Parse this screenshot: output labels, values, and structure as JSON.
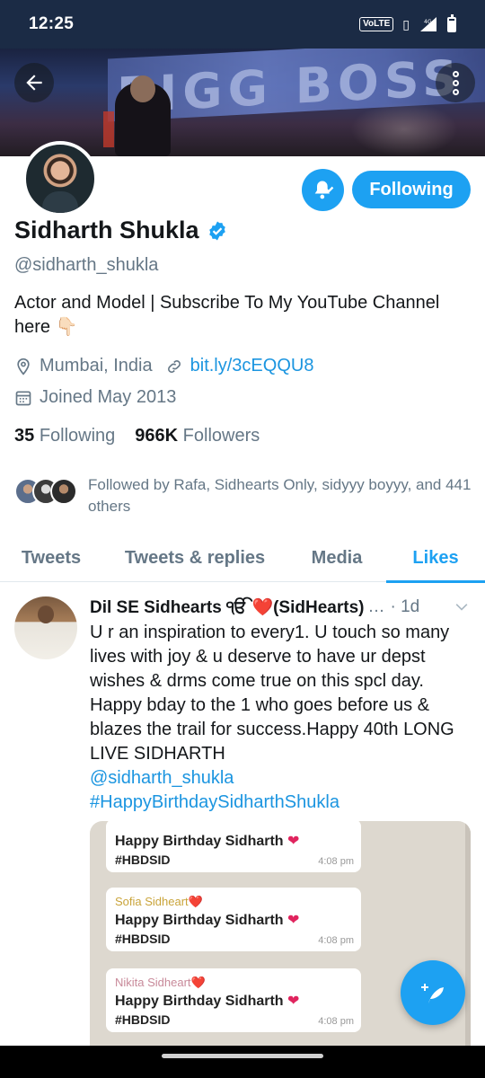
{
  "status_bar": {
    "time": "12:25",
    "volte": "VoLTE",
    "network": "4G"
  },
  "profile": {
    "name": "Sidharth Shukla",
    "handle": "@sidharth_shukla",
    "bio": "Actor and Model | Subscribe To My YouTube Channel here 👇🏻",
    "location": "Mumbai, India",
    "link": "bit.ly/3cEQQU8",
    "joined": "Joined May 2013",
    "following_count": "35",
    "following_label": "Following",
    "followers_count": "966K",
    "followers_label": "Followers",
    "followed_by": "Followed by Rafa, Sidhearts Only, sidyyy boyyy, and 441 others",
    "follow_button_label": "Following"
  },
  "tabs": [
    {
      "label": "Tweets",
      "active": false
    },
    {
      "label": "Tweets & replies",
      "active": false
    },
    {
      "label": "Media",
      "active": false
    },
    {
      "label": "Likes",
      "active": true
    }
  ],
  "tweet": {
    "author": "Dil SE Sidhearts ੴ ❤️(SidHearts)",
    "ellipsis": "…",
    "time": "· 1d",
    "text": "U r an inspiration to every1. U touch so many lives with joy & u deserve to have ur depst wishes & drms come true on this spcl day. Happy bday to the 1 who goes before us & blazes the trail for success.Happy 40th LONG LIVE SIDHARTH",
    "mention": "@sidharth_shukla",
    "hashtag": "#HappyBirthdaySidharthShukla",
    "media_messages": [
      {
        "sender": "",
        "line1": "Happy Birthday Sidharth ❤️",
        "line2": "#HBDSID",
        "time": "4:08 pm"
      },
      {
        "sender": "Sofia Sidheart❤️",
        "line1": "Happy Birthday Sidharth ❤️",
        "line2": "#HBDSID",
        "time": "4:08 pm"
      },
      {
        "sender": "Nikita Sidheart❤️",
        "line1": "Happy Birthday Sidharth ❤️",
        "line2": "#HBDSID",
        "time": "4:08 pm"
      }
    ]
  },
  "colors": {
    "accent": "#1da1f2",
    "status_bar": "#1b2b45",
    "secondary_text": "#657786",
    "link": "#1b95e0"
  },
  "icons": [
    "back-arrow-icon",
    "more-vertical-icon",
    "bell-icon",
    "verified-badge-icon",
    "location-pin-icon",
    "link-icon",
    "calendar-icon",
    "chevron-down-icon",
    "compose-tweet-icon"
  ]
}
